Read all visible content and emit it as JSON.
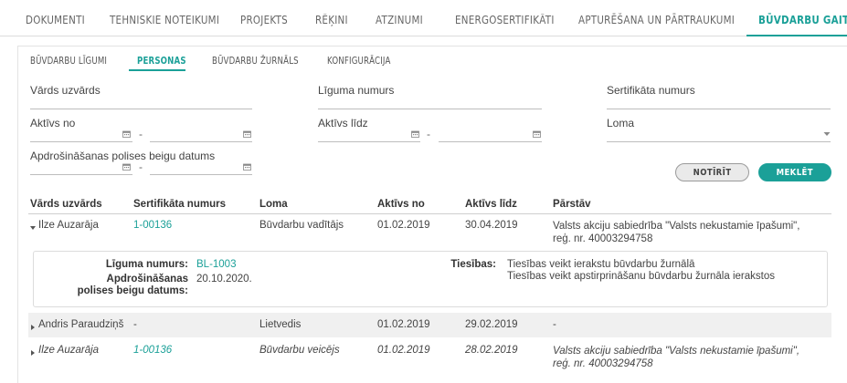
{
  "top_tabs": [
    {
      "label": "DOKUMENTI"
    },
    {
      "label": "TEHNISKIE NOTEIKUMI"
    },
    {
      "label": "PROJEKTS"
    },
    {
      "label": "RĒĶINI"
    },
    {
      "label": "ATZINUMI"
    },
    {
      "label": "ENERGOSERTIFIKĀTI"
    },
    {
      "label": "APTURĒŠANA UN PĀRTRAUKUMI"
    },
    {
      "label": "BŪVDARBU GAITA"
    }
  ],
  "sub_tabs": [
    {
      "label": "BŪVDARBU LĪGUMI"
    },
    {
      "label": "PERSONAS"
    },
    {
      "label": "BŪVDARBU ŽURNĀLS"
    },
    {
      "label": "KONFIGURĀCIJA"
    }
  ],
  "filters": {
    "name": {
      "label": "Vārds uzvārds",
      "value": ""
    },
    "contract": {
      "label": "Līguma numurs",
      "value": ""
    },
    "certificate": {
      "label": "Sertifikāta numurs",
      "value": ""
    },
    "active_from": {
      "label": "Aktīvs no",
      "separator": "-"
    },
    "active_to": {
      "label": "Aktīvs līdz",
      "separator": "-"
    },
    "role": {
      "label": "Loma",
      "value": ""
    },
    "insurance_end": {
      "label": "Apdrošināšanas polises beigu datums",
      "separator": "-"
    }
  },
  "buttons": {
    "clear": "NOTĪRĪT",
    "search": "MEKLĒT"
  },
  "table": {
    "columns": [
      "Vārds uzvārds",
      "Sertifikāta numurs",
      "Loma",
      "Aktīvs no",
      "Aktīvs līdz",
      "Pārstāv"
    ],
    "rows": [
      {
        "name": "Ilze Auzarāja",
        "certificate": "1-00136",
        "role": "Būvdarbu vadītājs",
        "from": "01.02.2019",
        "to": "30.04.2019",
        "represents": "Valsts akciju sabiedrība \"Valsts nekustamie īpašumi\", reģ. nr. 40003294758"
      },
      {
        "name": "Andris Paraudziņš",
        "certificate": "-",
        "role": "Lietvedis",
        "from": "01.02.2019",
        "to": "29.02.2019",
        "represents": "-"
      },
      {
        "name": "Ilze Auzarāja",
        "certificate": "1-00136",
        "role": "Būvdarbu veicējs",
        "from": "01.02.2019",
        "to": "28.02.2019",
        "represents": "Valsts akciju sabiedrība \"Valsts nekustamie īpašumi\", reģ. nr. 40003294758"
      }
    ],
    "detail": {
      "contract_label": "Līguma numurs:",
      "contract_value": "BL-1003",
      "insurance_label": "Apdrošināšanas polises beigu datums:",
      "insurance_value": "20.10.2020.",
      "rights_label": "Tiesības:",
      "rights": [
        "Tiesības veikt ierakstu būvdarbu žurnālā",
        "Tiesības veikt apstirprināšanu būvdarbu žurnāla ierakstos"
      ]
    }
  },
  "colors": {
    "accent": "#1ba098",
    "row_highlight": "#f0f0f0"
  },
  "icons": {
    "calendar": "calendar-icon",
    "dropdown": "chevron-down-icon",
    "expand": "triangle-right-icon",
    "collapse": "triangle-down-icon"
  }
}
